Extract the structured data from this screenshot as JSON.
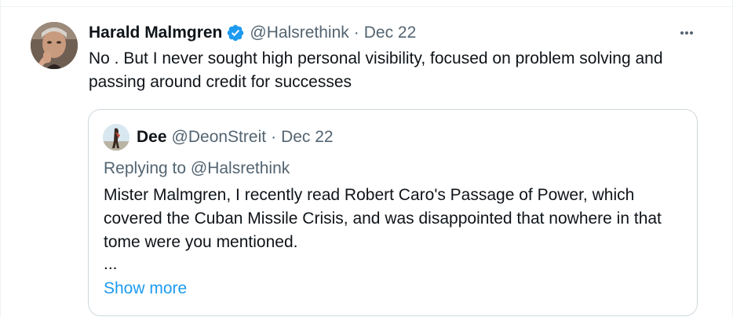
{
  "tweet": {
    "author_name": "Harald Malmgren",
    "verified_icon": "verified-badge-icon",
    "handle": "@Halsrethink",
    "separator": "·",
    "date": "Dec 22",
    "more_icon": "more-horizontal-icon",
    "text": "No .  But I never sought high personal visibility, focused on problem solving and passing around credit for successes"
  },
  "quoted_tweet": {
    "author_name": "Dee",
    "handle": "@DeonStreit",
    "separator": "·",
    "date": "Dec 22",
    "replying_to": "Replying to @Halsrethink",
    "text": "Mister Malmgren, I recently read Robert Caro's Passage of Power, which covered the Cuban Missile Crisis, and was disappointed that nowhere in that tome were you mentioned.",
    "ellipsis": "...",
    "show_more": "Show more"
  },
  "colors": {
    "text_primary": "#0f1419",
    "text_secondary": "#536471",
    "link": "#1d9bf0",
    "verified": "#1d9bf0",
    "border": "#cfd9de"
  }
}
